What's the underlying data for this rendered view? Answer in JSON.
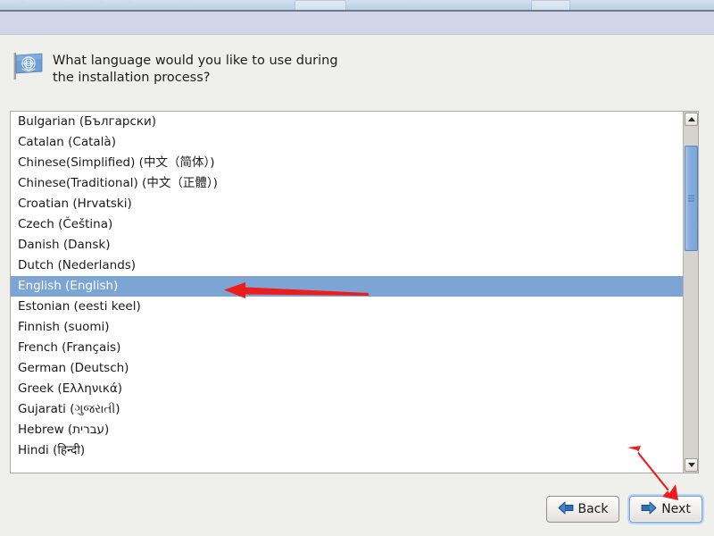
{
  "window": {
    "background_color": "#efefeb",
    "band_color": "#d2d6e8",
    "accent_color": "#7da5d4",
    "annotation_color": "#ee1c1c"
  },
  "header": {
    "icon": "un-flag-icon",
    "prompt": "What language would you like to use during the installation process?"
  },
  "language_list": {
    "selected": "English (English)",
    "items": [
      "Bulgarian (Български)",
      "Catalan (Català)",
      "Chinese(Simplified) (中文（简体）)",
      "Chinese(Traditional) (中文（正體）)",
      "Croatian (Hrvatski)",
      "Czech (Čeština)",
      "Danish (Dansk)",
      "Dutch (Nederlands)",
      "English (English)",
      "Estonian (eesti keel)",
      "Finnish (suomi)",
      "French (Français)",
      "German (Deutsch)",
      "Greek (Ελληνικά)",
      "Gujarati (ગુજરાતી)",
      "Hebrew (עברית)",
      "Hindi (हिन्दी)"
    ]
  },
  "scrollbar": {
    "up_arrow": "scroll-up-icon",
    "down_arrow": "scroll-down-icon"
  },
  "buttons": {
    "back": {
      "label": "Back",
      "icon": "arrow-left-icon"
    },
    "next": {
      "label": "Next",
      "icon": "arrow-right-icon"
    }
  },
  "annotations": [
    {
      "name": "arrow-pointing-to-selected-language",
      "direction": "left"
    },
    {
      "name": "arrow-pointing-to-next-button",
      "direction": "down-right"
    }
  ]
}
